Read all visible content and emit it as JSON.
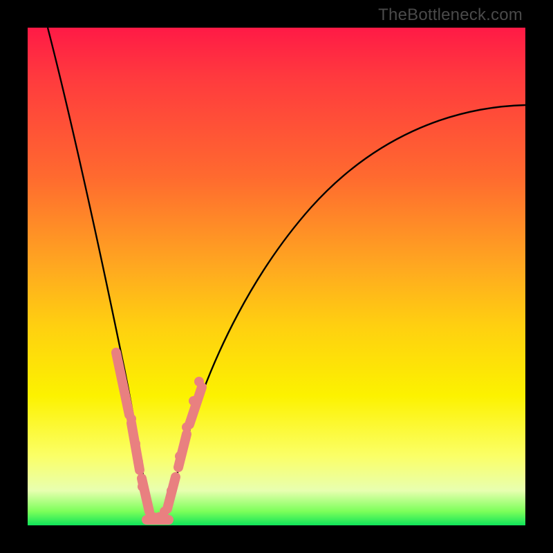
{
  "watermark": "TheBottleneck.com",
  "colors": {
    "background": "#000000",
    "gradient_top": "#ff1a46",
    "gradient_bottom": "#10e45a",
    "curve": "#000000",
    "marker_fill": "#e98080"
  },
  "chart_data": {
    "type": "line",
    "title": "",
    "xlabel": "",
    "ylabel": "",
    "xlim": [
      0,
      100
    ],
    "ylim": [
      0,
      100
    ],
    "legend": false,
    "axes_visible": false,
    "note": "Axis tick labels are not rendered in the image; x/y values below are estimated in percent of the visible plot area (0 = left/bottom, 100 = right/top).",
    "series": [
      {
        "name": "bottleneck-curve",
        "style": "line",
        "color": "#000000",
        "x": [
          4,
          6,
          8,
          10,
          12,
          14,
          16,
          18,
          19,
          20,
          21,
          22,
          23,
          24,
          25,
          26,
          28,
          30,
          32,
          34,
          37,
          40,
          45,
          50,
          55,
          60,
          65,
          70,
          75,
          80,
          85,
          90,
          95,
          100
        ],
        "y": [
          100,
          92,
          84,
          76,
          68,
          59,
          50,
          40,
          34,
          28,
          22,
          15,
          8,
          3,
          1,
          2,
          6,
          12,
          19,
          25,
          33,
          40,
          49,
          56,
          62,
          67,
          71,
          74,
          77,
          79,
          81,
          82,
          83,
          84
        ]
      },
      {
        "name": "highlighted-left-descent",
        "style": "thick-segment",
        "color": "#e98080",
        "x": [
          17.5,
          20.5,
          21.0,
          23.5,
          24.0,
          25.5
        ],
        "y": [
          35,
          23,
          22,
          8,
          6,
          2
        ]
      },
      {
        "name": "highlighted-trough",
        "style": "thick-segment",
        "color": "#e98080",
        "x": [
          22.5,
          28.0
        ],
        "y": [
          1.5,
          2.5
        ]
      },
      {
        "name": "highlighted-right-ascent",
        "style": "thick-segment",
        "color": "#e98080",
        "x": [
          27.0,
          28.8,
          29.3,
          31.0,
          31.8,
          34.0
        ],
        "y": [
          6,
          12,
          14,
          20,
          23,
          29
        ]
      },
      {
        "name": "highlighted-dots",
        "style": "scatter",
        "color": "#e98080",
        "x": [
          20.8,
          21.6,
          22.2,
          23.0,
          25.2,
          26.3,
          27.5,
          28.6,
          30.2,
          31.4,
          33.0
        ],
        "y": [
          22,
          17,
          13,
          8,
          2,
          3,
          6,
          10,
          16,
          22,
          27
        ]
      }
    ]
  }
}
